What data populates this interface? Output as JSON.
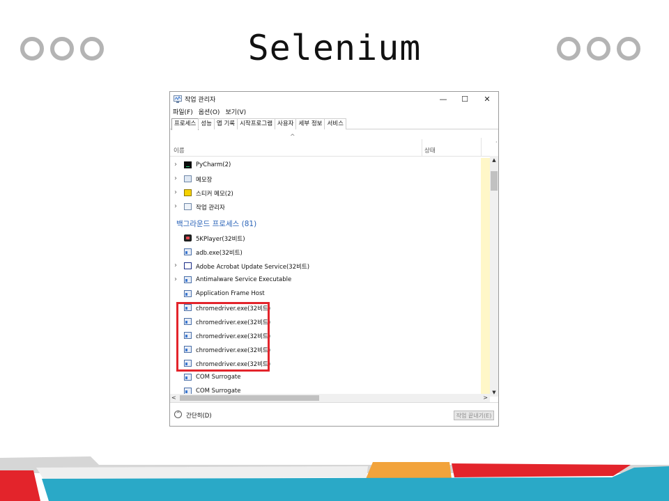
{
  "slide": {
    "title": "Selenium",
    "colors": {
      "circle": "#b4b4b4",
      "footer_gray": "#d6d6d6",
      "footer_red": "#e3242b",
      "footer_orange": "#f2a33b",
      "footer_blue": "#2aa9c7",
      "highlight": "#e3242b"
    }
  },
  "window": {
    "title": "작업 관리자",
    "controls": {
      "minimize": "—",
      "maximize": "☐",
      "close": "✕"
    },
    "menu": [
      "파일(F)",
      "옵션(O)",
      "보기(V)"
    ],
    "tabs": [
      "프로세스",
      "성능",
      "앱 기록",
      "시작프로그램",
      "사용자",
      "세부 정보",
      "서비스"
    ],
    "active_tab": "프로세스",
    "columns": {
      "name": "이름",
      "status": "상태",
      "sort_indicator": "^",
      "more": "·"
    },
    "apps": [
      {
        "name": "PyCharm(2)",
        "icon": "pycharm-icon"
      },
      {
        "name": "메모장",
        "icon": "notepad-icon"
      },
      {
        "name": "스티커 메모(2)",
        "icon": "sticky-notes-icon"
      },
      {
        "name": "작업 관리자",
        "icon": "task-manager-icon"
      }
    ],
    "background_header": "백그라운드 프로세스 (81)",
    "background": [
      {
        "name": "5KPlayer(32비트)",
        "expandable": false,
        "icon": "5kplayer-icon"
      },
      {
        "name": "adb.exe(32비트)",
        "expandable": false,
        "icon": "exe-icon"
      },
      {
        "name": "Adobe Acrobat Update Service(32비트)",
        "expandable": true,
        "icon": "acrobat-icon"
      },
      {
        "name": "Antimalware Service Executable",
        "expandable": true,
        "icon": "exe-icon"
      },
      {
        "name": "Application Frame Host",
        "expandable": false,
        "icon": "exe-icon"
      },
      {
        "name": "chromedriver.exe(32비트)",
        "expandable": false,
        "icon": "exe-icon"
      },
      {
        "name": "chromedriver.exe(32비트)",
        "expandable": false,
        "icon": "exe-icon"
      },
      {
        "name": "chromedriver.exe(32비트)",
        "expandable": false,
        "icon": "exe-icon"
      },
      {
        "name": "chromedriver.exe(32비트)",
        "expandable": false,
        "icon": "exe-icon"
      },
      {
        "name": "chromedriver.exe(32비트)",
        "expandable": false,
        "icon": "exe-icon"
      },
      {
        "name": "COM Surrogate",
        "expandable": false,
        "icon": "exe-icon"
      },
      {
        "name": "COM Surrogate",
        "expandable": false,
        "icon": "exe-icon"
      }
    ],
    "scroll": {
      "up": "▲",
      "down": "▼",
      "left": "<",
      "right": ">"
    },
    "footer": {
      "fewer_details": "간단히(D)",
      "fewer_icon": "^",
      "end_task": "작업 끝내기(E)"
    }
  }
}
